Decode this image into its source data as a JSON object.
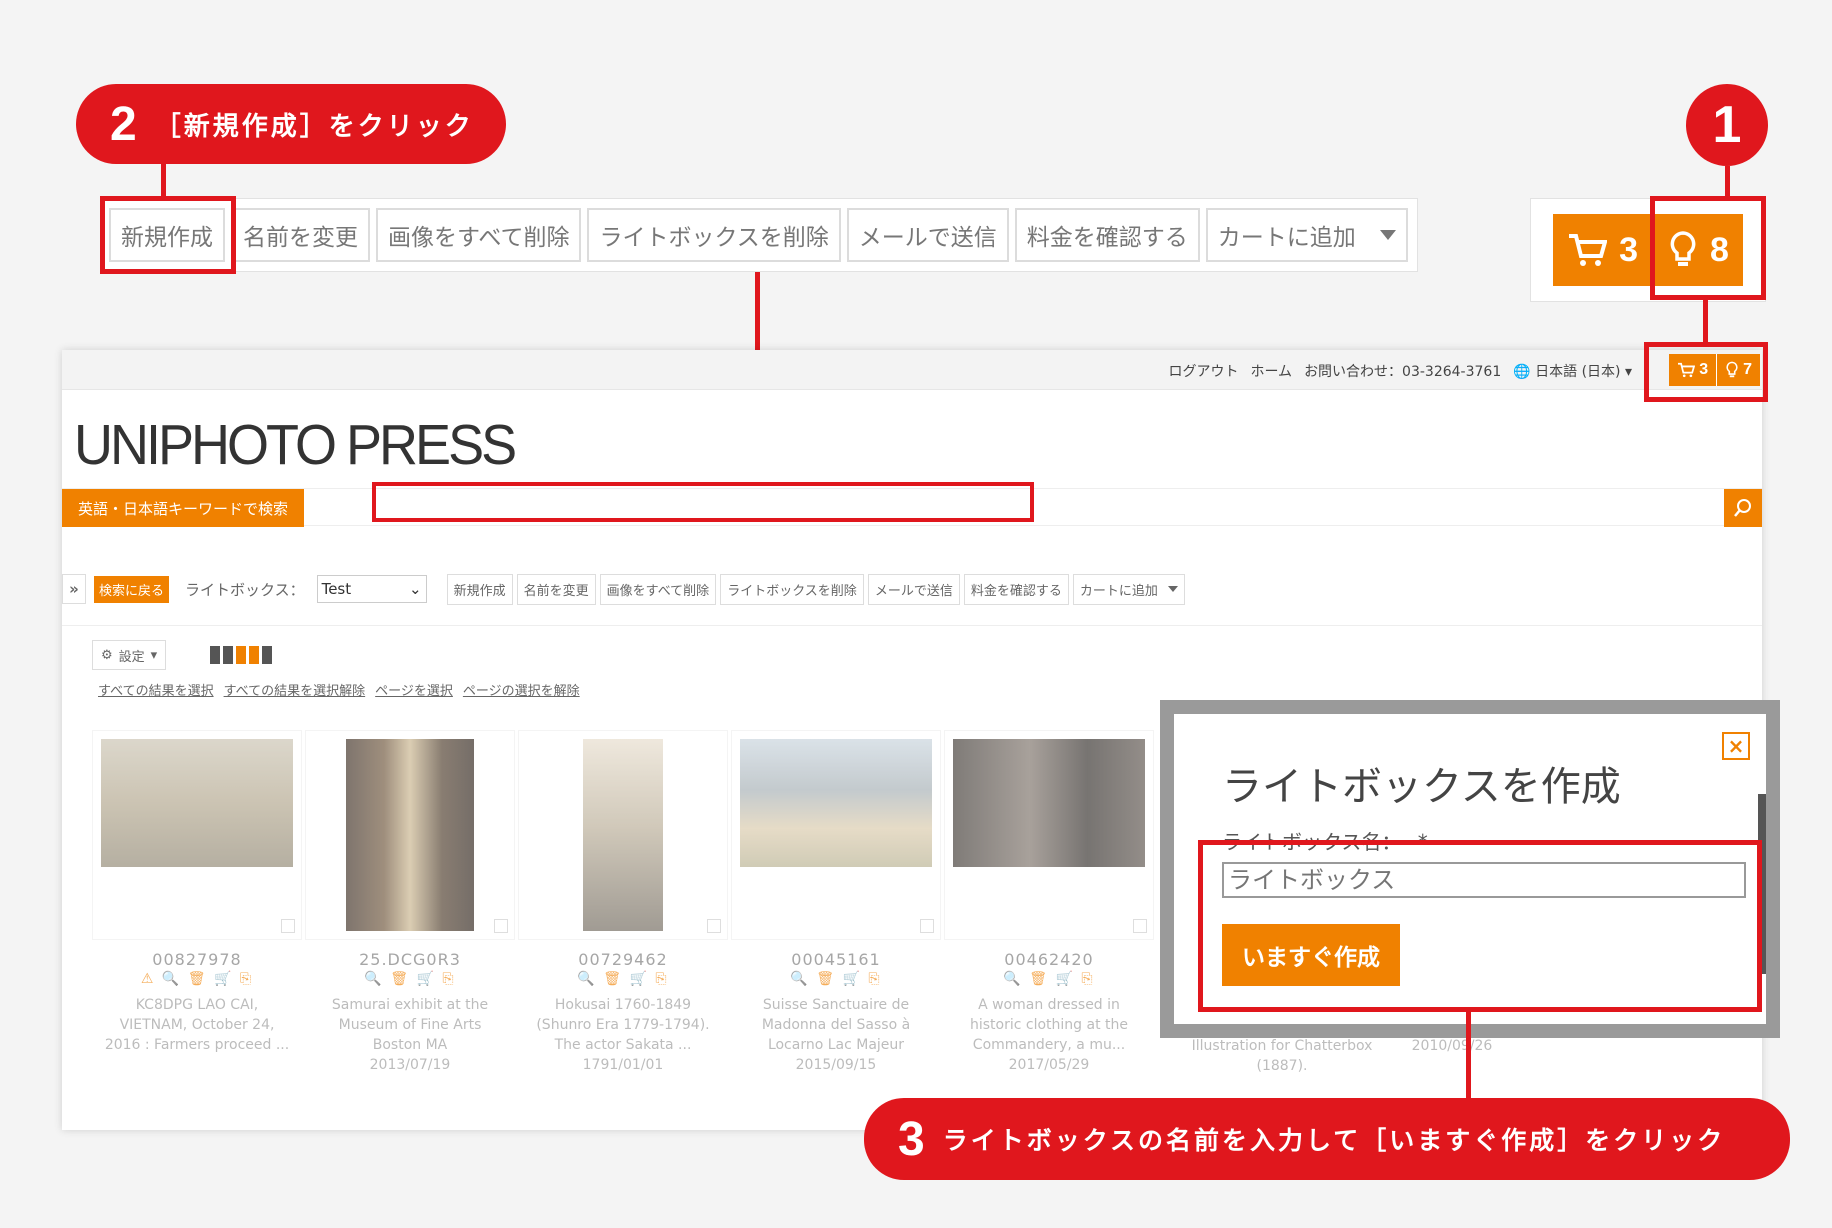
{
  "callouts": {
    "step1": {
      "number": "1"
    },
    "step2": {
      "number": "2",
      "text": "［新規作成］をクリック"
    },
    "step3": {
      "number": "3",
      "text": "ライトボックスの名前を入力して［いますぐ作成］をクリック"
    }
  },
  "toolbar": {
    "buttons": [
      "新規作成",
      "名前を変更",
      "画像をすべて削除",
      "ライトボックスを削除",
      "メールで送信",
      "料金を確認する",
      "カートに追加"
    ]
  },
  "cart_widget": {
    "cart_count": "3",
    "lightbox_count": "8"
  },
  "site": {
    "topbar_links": [
      "ログアウト",
      "ホーム",
      "お問い合わせ：03-3264-3761",
      "日本語 (日本)"
    ],
    "mini_cart_count": "3",
    "mini_lightbox_count": "7",
    "logo": "UNIPHOTO PRESS",
    "search_label": "英語・日本語キーワードで検索",
    "back_button": "検索に戻る",
    "lightbox_label": "ライトボックス：",
    "lightbox_selected": "Test",
    "settings_label": "設定",
    "select_links": [
      "すべての結果を選択",
      "すべての結果を選択解除",
      "ページを選択",
      "ページの選択を解除"
    ]
  },
  "results": [
    {
      "id": "00827978",
      "desc": [
        "KC8DPG LAO CAI,",
        "VIETNAM, October 24,",
        "2016 : Farmers proceed ..."
      ]
    },
    {
      "id": "25.DCG0R3",
      "desc": [
        "Samurai exhibit at the",
        "Museum of Fine Arts",
        "Boston MA",
        "2013/07/19"
      ]
    },
    {
      "id": "00729462",
      "desc": [
        "Hokusai 1760-1849",
        "(Shunro Era 1779-1794).",
        "The actor Sakata ...",
        "1791/01/01"
      ]
    },
    {
      "id": "00045161",
      "desc": [
        "Suisse Sanctuaire de",
        "Madonna del Sasso à",
        "Locarno Lac Majeur",
        "2015/09/15"
      ]
    },
    {
      "id": "00462420",
      "desc": [
        "A woman dressed in",
        "historic clothing at the",
        "Commandery, a mu...",
        "2017/05/29"
      ]
    }
  ],
  "hidden_results": [
    {
      "desc": [
        "Illustration for Chatterbox",
        "(1887)."
      ]
    },
    {
      "desc": [
        "2010/09/26"
      ]
    }
  ],
  "dialog": {
    "title": "ライトボックスを作成",
    "label": "ライトボックス名：",
    "required_mark": "*",
    "input_placeholder": "ライトボックス",
    "create_button": "いますぐ作成",
    "close": "×"
  },
  "colors": {
    "accent": "#f08100",
    "callout": "#e0171d"
  }
}
